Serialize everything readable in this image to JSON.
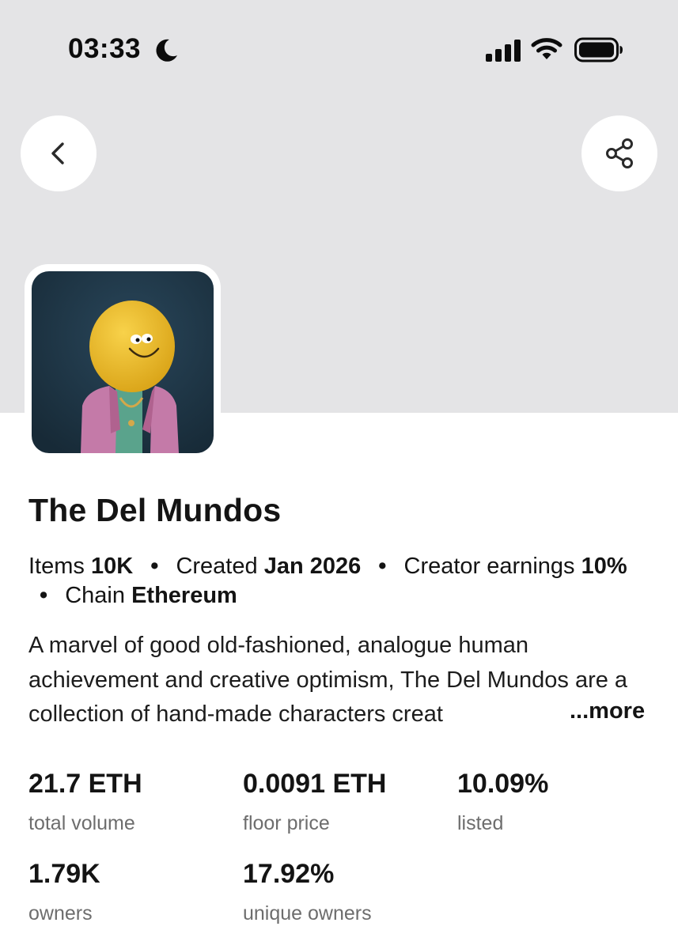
{
  "status_bar": {
    "time": "03:33",
    "icons": [
      "moon-icon",
      "cellular-signal-icon",
      "wifi-icon",
      "battery-icon"
    ]
  },
  "nav": {
    "back_icon": "chevron-left-icon",
    "share_icon": "share-icon"
  },
  "colors": {
    "banner": "#e4e4e6",
    "avatar_bg": "#1f3545",
    "avatar_face": "#f2c12e",
    "avatar_jacket": "#c47aa8",
    "label_gray": "#6d6d6d"
  },
  "collection": {
    "name": "The Del Mundos",
    "meta": {
      "items_label": "Items",
      "items_value": "10K",
      "created_label": "Created",
      "created_value": "Jan 2026",
      "earnings_label": "Creator earnings",
      "earnings_value": "10%",
      "chain_label": "Chain",
      "chain_value": "Ethereum",
      "separator": "•"
    },
    "description": "A marvel of good old-fashioned, analogue human achievement and creative optimism, The Del Mundos are a collection of hand-made characters creat",
    "more_label": "...more"
  },
  "stats": [
    {
      "value": "21.7 ETH",
      "label": "total volume"
    },
    {
      "value": "0.0091 ETH",
      "label": "floor price"
    },
    {
      "value": "10.09%",
      "label": "listed"
    },
    {
      "value": "1.79K",
      "label": "owners"
    },
    {
      "value": "17.92%",
      "label": "unique owners"
    }
  ]
}
